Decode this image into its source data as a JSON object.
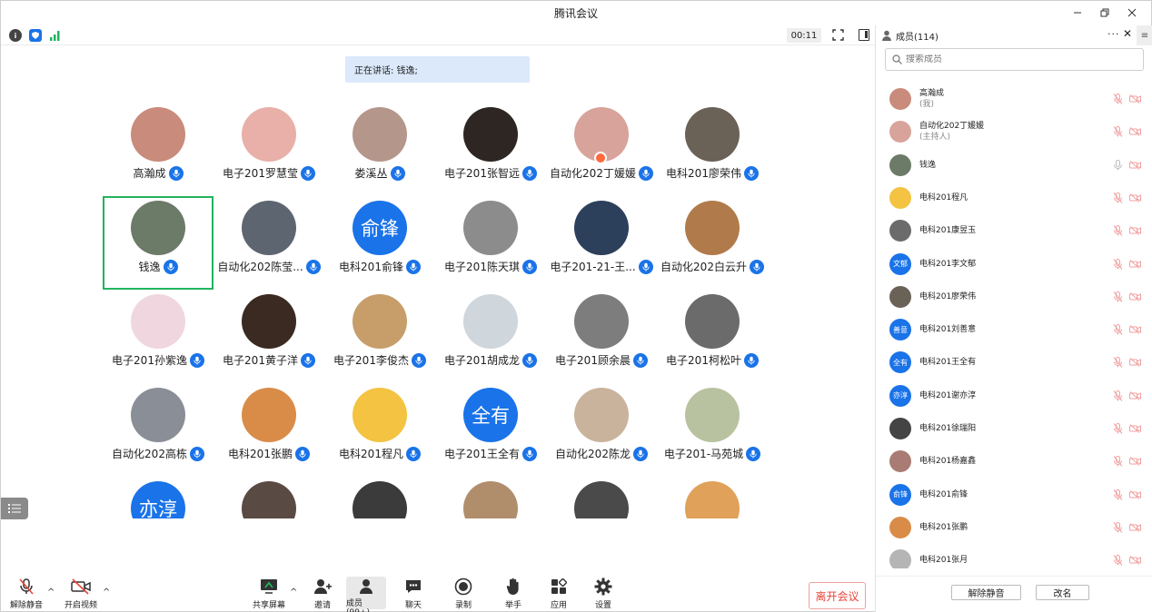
{
  "window": {
    "title": "腾讯会议"
  },
  "toolbar": {
    "timer": "00:11"
  },
  "speaking": {
    "label": "正在讲话: 钱逸;"
  },
  "tiles": [
    {
      "name": "高瀚成",
      "color": "#c98b7b",
      "initials": ""
    },
    {
      "name": "电子201罗慧莹",
      "color": "#e8b0a8",
      "initials": ""
    },
    {
      "name": "娄溪丛",
      "color": "#b5968a",
      "initials": ""
    },
    {
      "name": "电子201张智远",
      "color": "#2d2623",
      "initials": ""
    },
    {
      "name": "自动化202丁媛媛",
      "color": "#d8a39b",
      "initials": ""
    },
    {
      "name": "电科201廖荣伟",
      "color": "#6a6157",
      "initials": ""
    },
    {
      "name": "钱逸",
      "color": "#6c7a68",
      "initials": ""
    },
    {
      "name": "自动化202陈莹...",
      "color": "#5d6570",
      "initials": ""
    },
    {
      "name": "电科201俞锋",
      "color": "#1a73e8",
      "initials": "俞锋"
    },
    {
      "name": "电子201陈天琪",
      "color": "#8c8c8c",
      "initials": ""
    },
    {
      "name": "电子201-21-王...",
      "color": "#2c3f5b",
      "initials": ""
    },
    {
      "name": "自动化202白云升",
      "color": "#b17a4a",
      "initials": ""
    },
    {
      "name": "电子201孙紫逸",
      "color": "#f0d6df",
      "initials": ""
    },
    {
      "name": "电子201黄子洋",
      "color": "#3a2a22",
      "initials": ""
    },
    {
      "name": "电子201李俊杰",
      "color": "#c79d6a",
      "initials": ""
    },
    {
      "name": "电子201胡成龙",
      "color": "#cfd6dc",
      "initials": ""
    },
    {
      "name": "电子201顾余晨",
      "color": "#7d7d7d",
      "initials": ""
    },
    {
      "name": "电子201柯松叶",
      "color": "#6b6b6b",
      "initials": ""
    },
    {
      "name": "自动化202高栋",
      "color": "#8a8e97",
      "initials": ""
    },
    {
      "name": "电科201张鹏",
      "color": "#d98c48",
      "initials": ""
    },
    {
      "name": "电科201程凡",
      "color": "#f3c341",
      "initials": ""
    },
    {
      "name": "电子201王全有",
      "color": "#1a73e8",
      "initials": "全有"
    },
    {
      "name": "自动化202陈龙",
      "color": "#c9b39c",
      "initials": ""
    },
    {
      "name": "电子201-马苑城",
      "color": "#b9c2a0",
      "initials": ""
    },
    {
      "name": "",
      "color": "#1a73e8",
      "initials": "亦淳"
    },
    {
      "name": "",
      "color": "#5a4a44",
      "initials": ""
    },
    {
      "name": "",
      "color": "#3b3b3b",
      "initials": ""
    },
    {
      "name": "",
      "color": "#b08e6c",
      "initials": ""
    },
    {
      "name": "",
      "color": "#4a4a4a",
      "initials": ""
    },
    {
      "name": "",
      "color": "#e0a15a",
      "initials": ""
    }
  ],
  "bottom": {
    "unmute": "解除静音",
    "start_video": "开启视频",
    "share": "共享屏幕",
    "invite": "邀请",
    "members": "成员(99+)",
    "chat": "聊天",
    "record": "录制",
    "raise_hand": "举手",
    "apps": "应用",
    "settings": "设置",
    "leave": "离开会议"
  },
  "panel": {
    "title": "成员(114)",
    "search_placeholder": "搜索成员",
    "footer_unmute": "解除静音",
    "footer_rename": "改名",
    "members": [
      {
        "name": "高瀚成",
        "sub": "(我)",
        "color": "#c98b7b",
        "initials": ""
      },
      {
        "name": "自动化202丁媛媛",
        "sub": "(主持人)",
        "color": "#d8a39b",
        "initials": ""
      },
      {
        "name": "钱逸",
        "sub": "",
        "color": "#6c7a68",
        "initials": ""
      },
      {
        "name": "电科201程凡",
        "sub": "",
        "color": "#f3c341",
        "initials": ""
      },
      {
        "name": "电科201康昱玉",
        "sub": "",
        "color": "#6b6b6b",
        "initials": ""
      },
      {
        "name": "电科201李文郁",
        "sub": "",
        "color": "#1a73e8",
        "initials": "文郁"
      },
      {
        "name": "电科201廖荣伟",
        "sub": "",
        "color": "#6a6157",
        "initials": ""
      },
      {
        "name": "电科201刘善意",
        "sub": "",
        "color": "#1a73e8",
        "initials": "善意"
      },
      {
        "name": "电科201王全有",
        "sub": "",
        "color": "#1a73e8",
        "initials": "全有"
      },
      {
        "name": "电科201谢亦淳",
        "sub": "",
        "color": "#1a73e8",
        "initials": "亦淳"
      },
      {
        "name": "电科201徐瑞阳",
        "sub": "",
        "color": "#444444",
        "initials": ""
      },
      {
        "name": "电科201杨嘉鑫",
        "sub": "",
        "color": "#a87c72",
        "initials": ""
      },
      {
        "name": "电科201俞锋",
        "sub": "",
        "color": "#1a73e8",
        "initials": "俞锋"
      },
      {
        "name": "电科201张鹏",
        "sub": "",
        "color": "#d98c48",
        "initials": ""
      },
      {
        "name": "电科201张月",
        "sub": "",
        "color": "#b5b5b5",
        "initials": ""
      }
    ]
  }
}
